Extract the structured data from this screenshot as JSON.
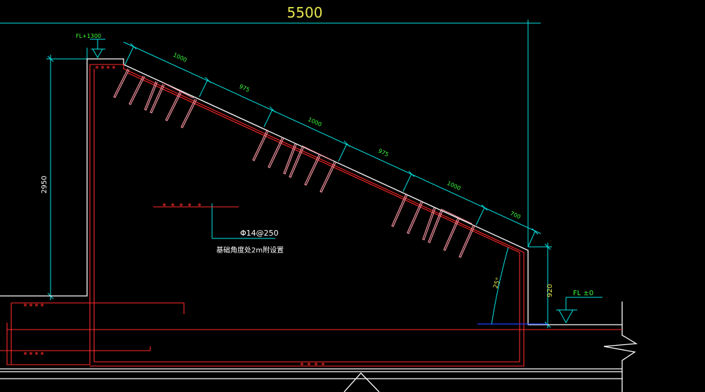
{
  "drawing": {
    "overall_width_dim": "5500",
    "level_top": "FL+1300",
    "level_bottom": "FL ±0",
    "wall_height_dim": "2950",
    "right_height_dim": "920",
    "slope_angle": "25°",
    "slope_segments": [
      "1000",
      "975",
      "1000",
      "975",
      "1000",
      "700"
    ],
    "rebar_spec": "Φ14@250",
    "rebar_note": "基础角度处2m附设置"
  },
  "colors": {
    "background": "#000000",
    "outline": "#ffffff",
    "rebar": "#ff2a2a",
    "dimension": "#00e5e5",
    "dim_text_yellow": "#e6e64d",
    "dim_text_green": "#3cff3c",
    "anchor": "#ff9aa8",
    "blue_line": "#1e3cff"
  }
}
